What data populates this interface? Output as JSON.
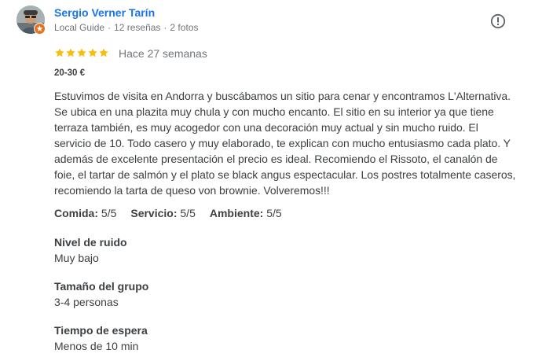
{
  "author": {
    "name": "Sergio Verner Tarín",
    "meta_level": "Local Guide",
    "meta_reviews": "12 reseñas",
    "meta_photos": "2 fotos",
    "meta_separator": "·",
    "avatar_icon": "user-photo",
    "badge_icon": "local-guide-star-icon"
  },
  "review": {
    "rating": 5,
    "max_rating": 5,
    "star_color": "#fbbc04",
    "date": "Hace 27 semanas",
    "price": "20-30 €",
    "text": "Estuvimos de visita en Andorra y buscábamos un sitio para cenar y encontramos L'Alternativa. Se ubica en una plazita muy chula y con mucho encanto. El sitio en su interior ya que tiene terraza también, es muy acogedor con una decoración muy actual y sin mucho ruido. El servicio de 10. Todo casero y muy elaborado, te explican con mucho entusiasmo cada plato. Y además de excelente presentación el precio es ideal. Recomiendo el Rissoto, el canalón de foie, el tartar de salmón y el plato se black angus espectacular. Los postres totalmente caseros, recomiendo la tarta de queso von brownie. Volveremos!!!",
    "report_icon": "report-icon"
  },
  "ratings": [
    {
      "label": "Comida:",
      "value": "5/5"
    },
    {
      "label": "Servicio:",
      "value": "5/5"
    },
    {
      "label": "Ambiente:",
      "value": "5/5"
    }
  ],
  "attributes": [
    {
      "label": "Nivel de ruido",
      "value": "Muy bajo"
    },
    {
      "label": "Tamaño del grupo",
      "value": "3-4 personas"
    },
    {
      "label": "Tiempo de espera",
      "value": "Menos de 10 min"
    }
  ],
  "colors": {
    "author_name": "#1a73e8",
    "meta_text": "#70757a",
    "body_text": "#3c4043",
    "badge": "#e8711a"
  }
}
